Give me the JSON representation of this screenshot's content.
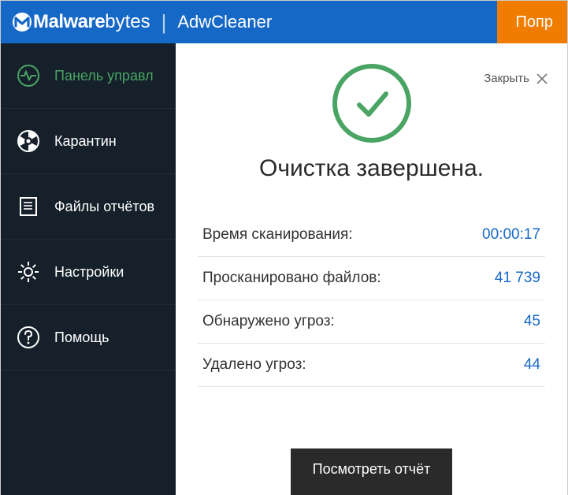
{
  "header": {
    "brand_bold": "Malware",
    "brand_light": "bytes",
    "product": "AdwCleaner",
    "action_button": "Попр"
  },
  "sidebar": {
    "items": [
      {
        "label": "Панель управл"
      },
      {
        "label": "Карантин"
      },
      {
        "label": "Файлы отчётов"
      },
      {
        "label": "Настройки"
      },
      {
        "label": "Помощь"
      }
    ]
  },
  "main": {
    "close_label": "Закрыть",
    "title": "Очистка завершена.",
    "stats": [
      {
        "label": "Время сканирования:",
        "value": "00:00:17"
      },
      {
        "label": "Просканировано файлов:",
        "value": "41 739"
      },
      {
        "label": "Обнаружено угроз:",
        "value": "45"
      },
      {
        "label": "Удалено угроз:",
        "value": "44"
      }
    ],
    "view_report": "Посмотреть отчёт"
  },
  "colors": {
    "accent_blue": "#1668c7",
    "accent_green": "#4aa564",
    "sidebar_bg": "#15202a",
    "orange": "#f07c00"
  }
}
